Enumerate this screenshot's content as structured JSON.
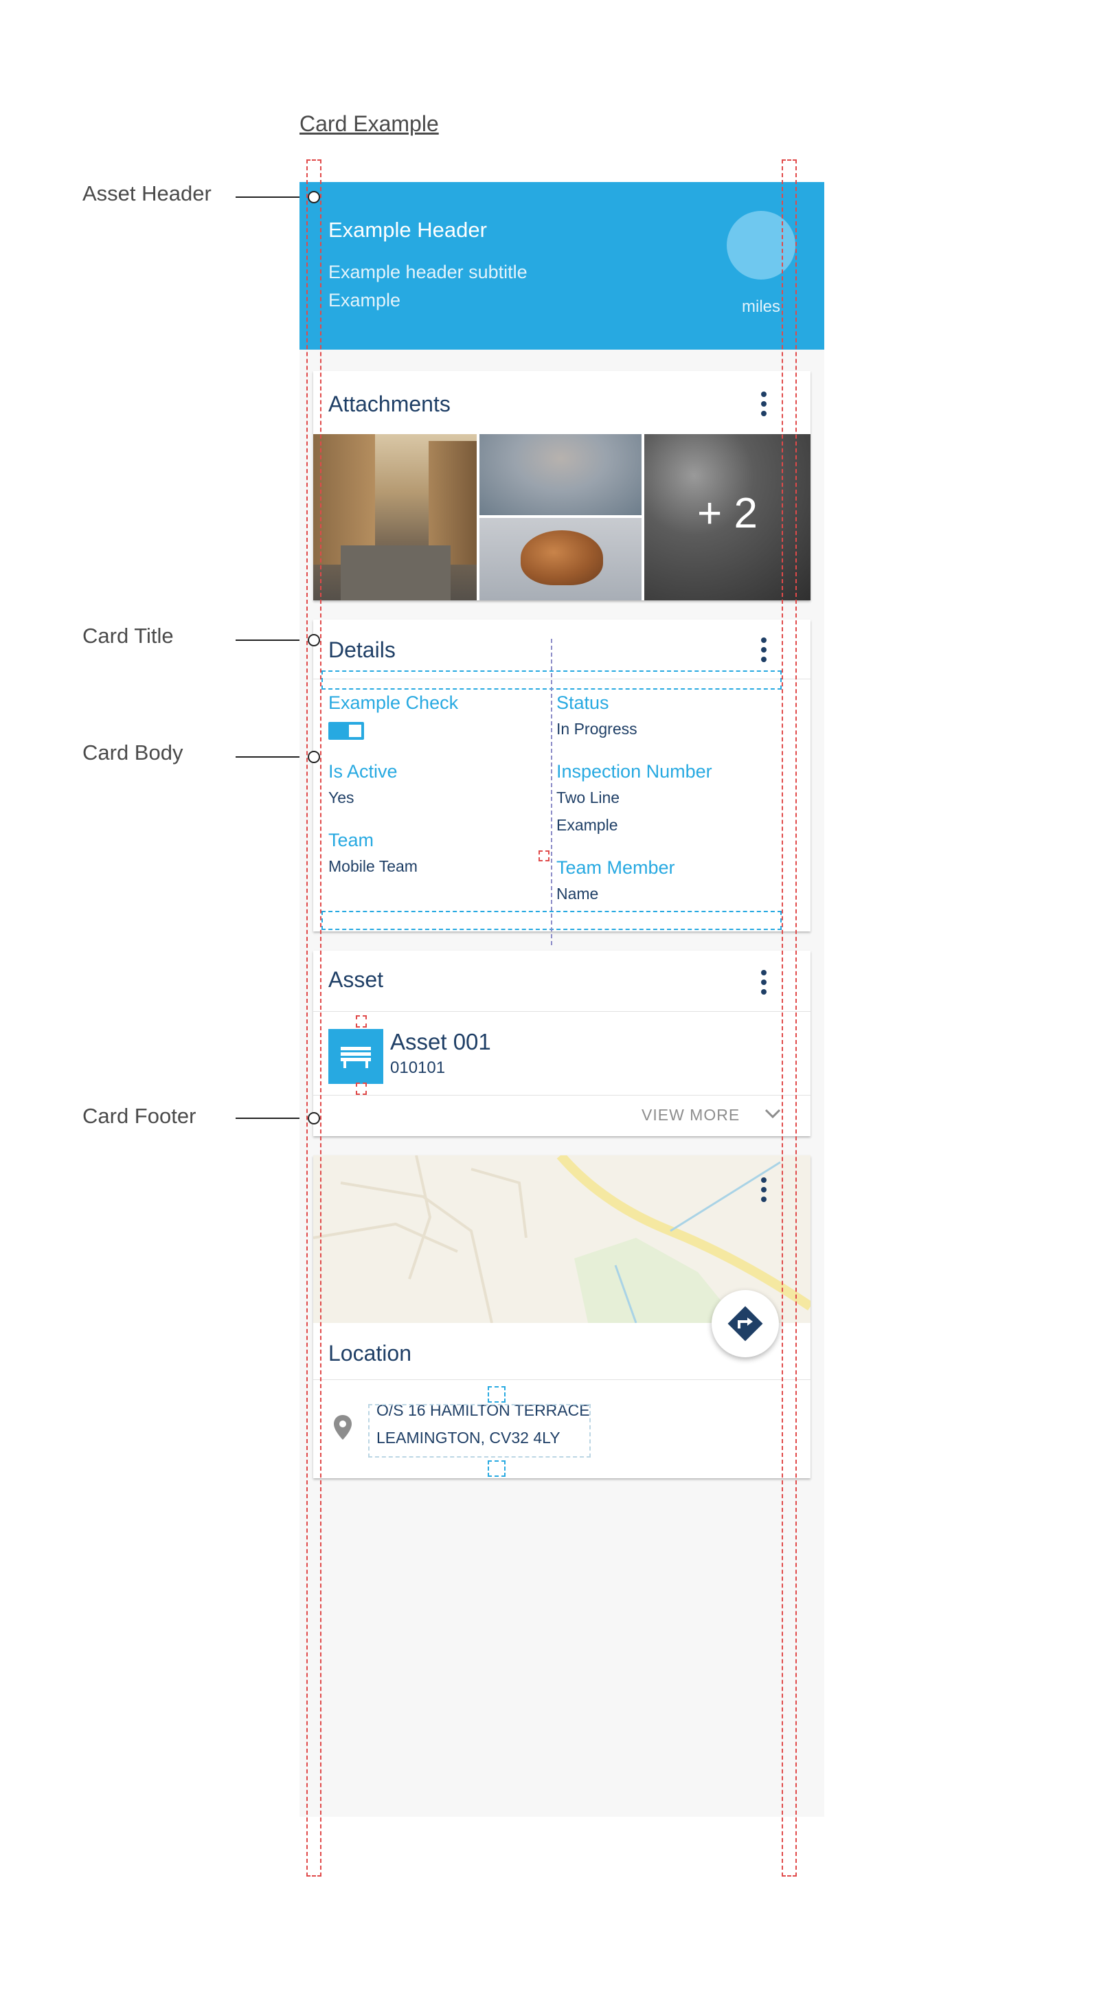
{
  "spec": {
    "title": "Card Example"
  },
  "annotations": {
    "asset_header": "Asset Header",
    "card_title": "Card Title",
    "card_body": "Card Body",
    "card_footer": "Card Footer"
  },
  "asset_header": {
    "title": "Example Header",
    "subtitle": "Example header subtitle",
    "subtitle2": "Example",
    "unit": "miles",
    "background_color": "#27a9e1"
  },
  "attachments_card": {
    "title": "Attachments",
    "more_count": "+ 2",
    "photos": [
      "street-photo",
      "rocks-photo",
      "cat-photo",
      "road-photo"
    ]
  },
  "details_card": {
    "title": "Details",
    "fields": {
      "example_check": {
        "label": "Example Check",
        "toggle": true
      },
      "status": {
        "label": "Status",
        "value": "In Progress"
      },
      "is_active": {
        "label": "Is Active",
        "value": "Yes"
      },
      "inspection_number": {
        "label": "Inspection Number",
        "value_line1": "Two Line",
        "value_line2": "Example"
      },
      "team": {
        "label": "Team",
        "value": "Mobile Team"
      },
      "team_member": {
        "label": "Team Member",
        "value": "Name"
      }
    }
  },
  "asset_card": {
    "title": "Asset",
    "asset_name": "Asset 001",
    "asset_code": "010101",
    "icon": "bench-icon",
    "view_more": "VIEW MORE"
  },
  "location_card": {
    "title": "Location",
    "address_line1": "O/S 16 HAMILTON TERRACE",
    "address_line2": "LEAMINGTON, CV32 4LY",
    "icons": [
      "map-pin-icon",
      "directions-icon"
    ]
  },
  "colors": {
    "accent": "#27a9e1",
    "text_primary": "#1f3f66",
    "guide_red": "#e04a4a"
  }
}
